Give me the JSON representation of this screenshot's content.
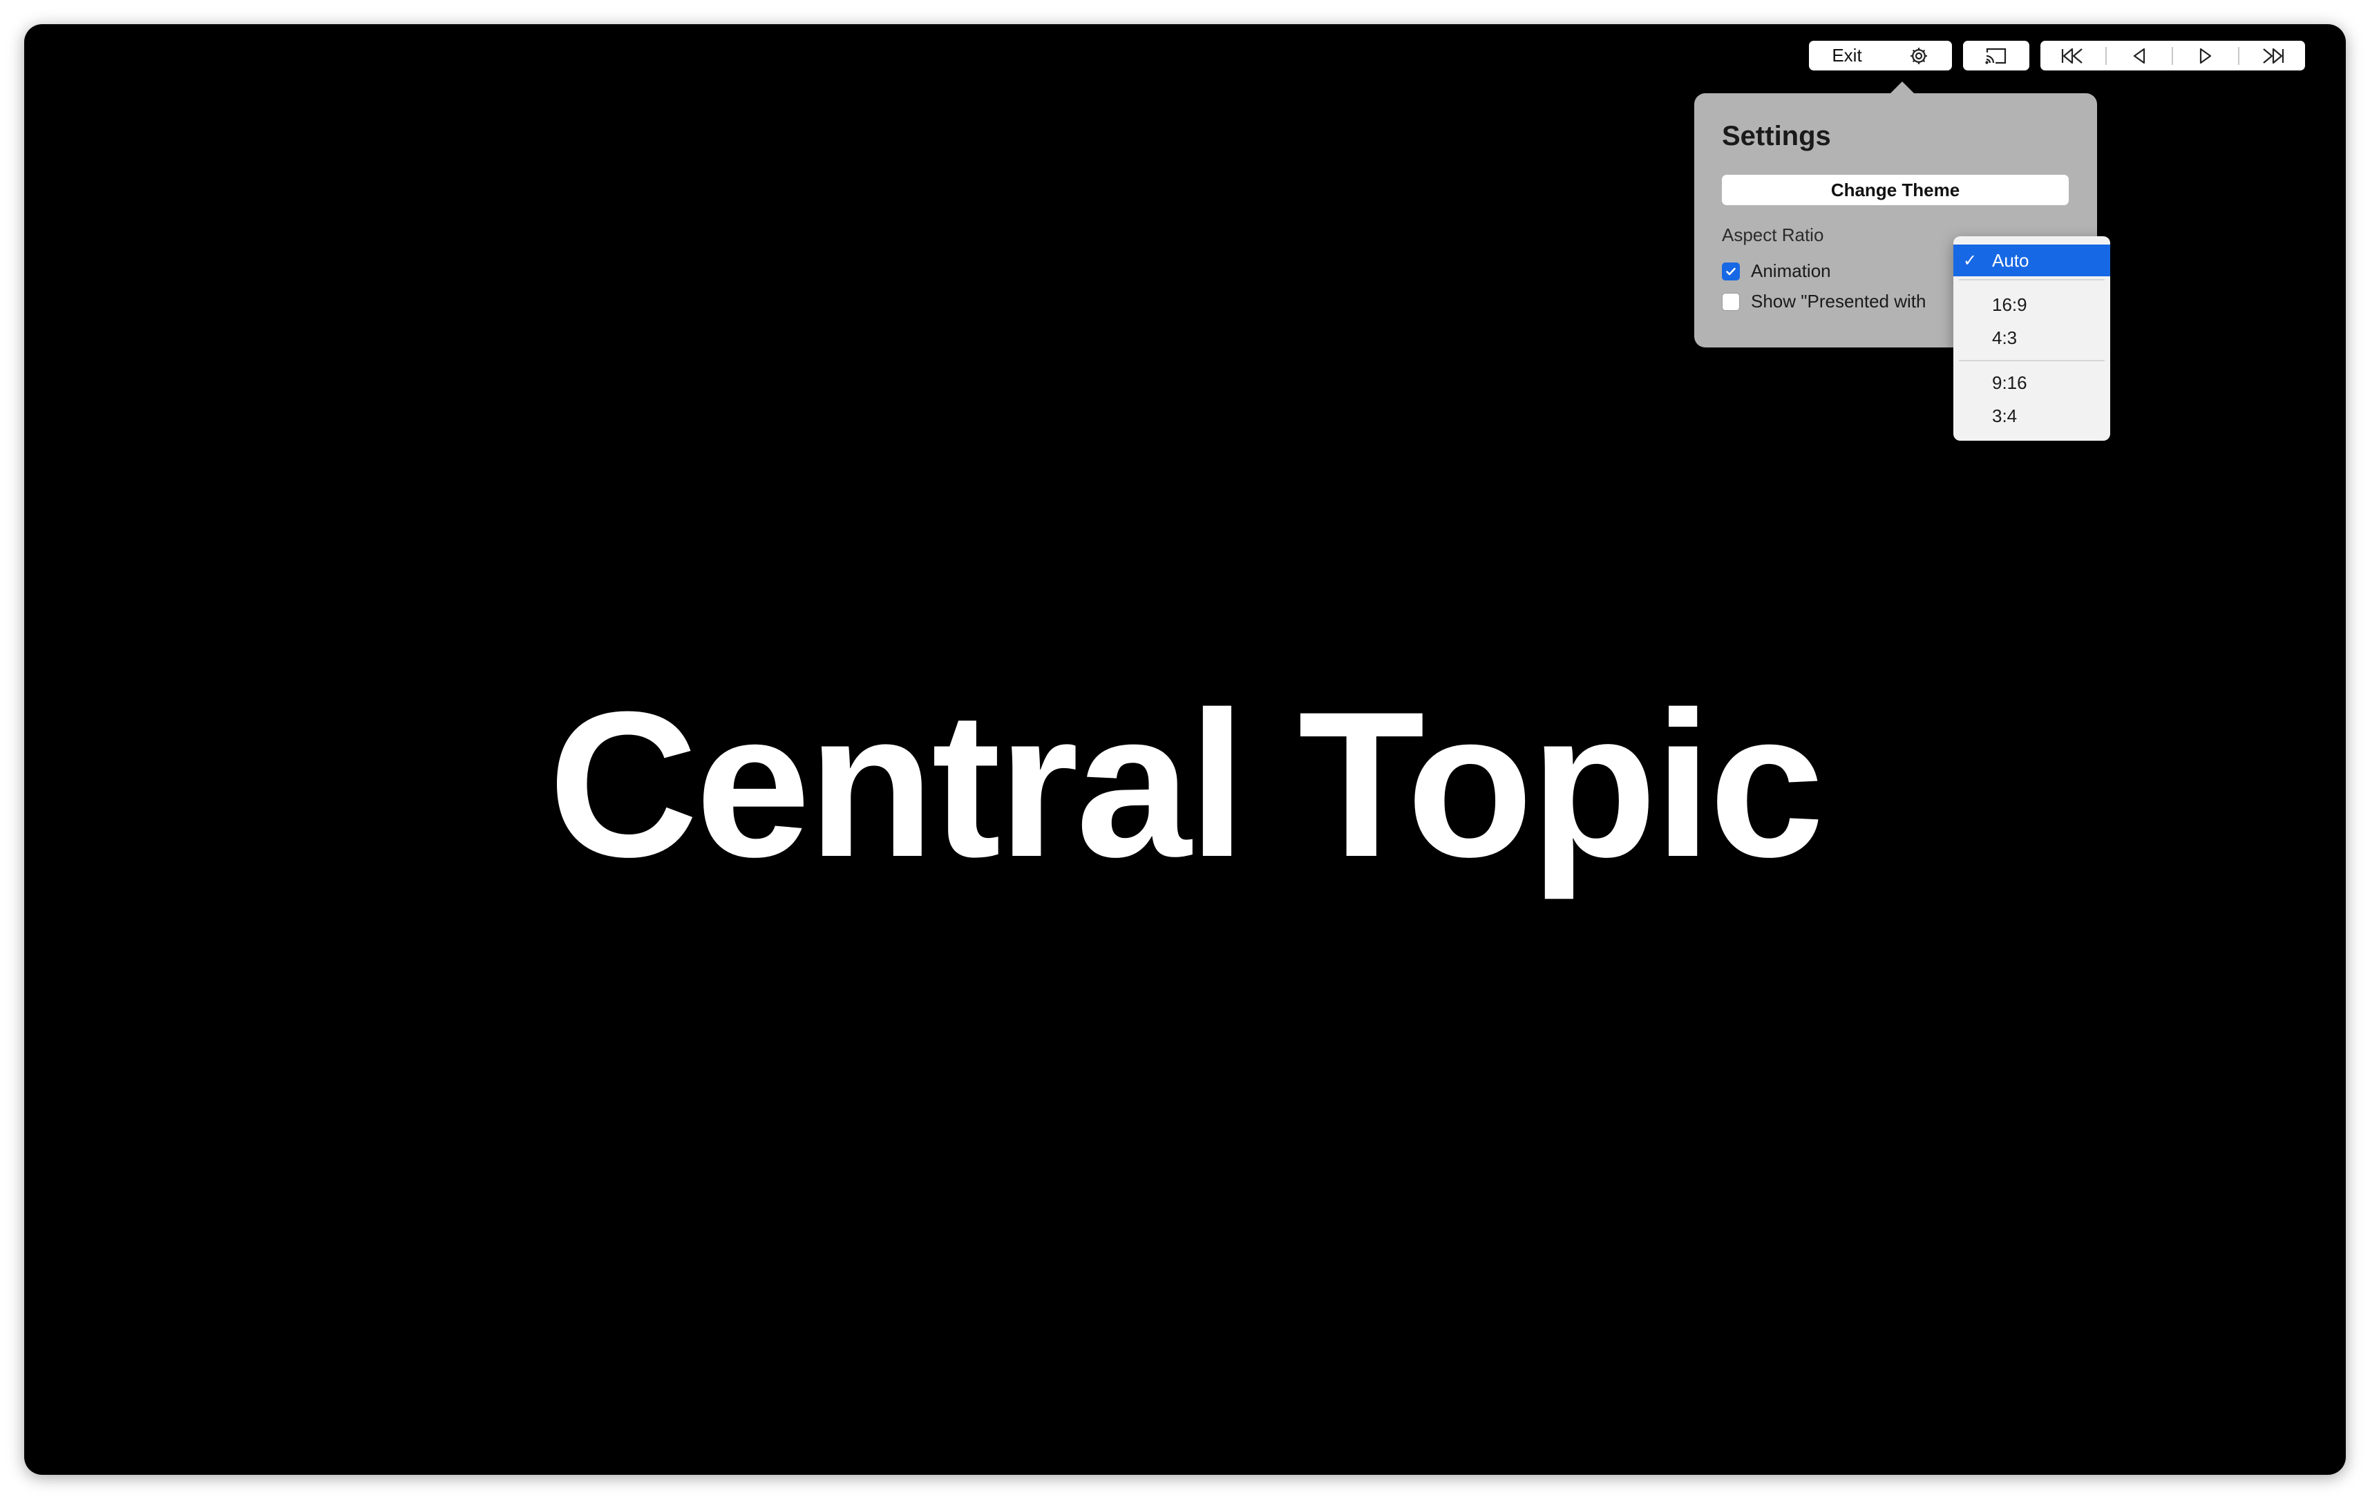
{
  "slide": {
    "title": "Central Topic"
  },
  "toolbar": {
    "exit_label": "Exit",
    "icons": [
      "gear-icon",
      "screen-share-icon",
      "first-slide-icon",
      "previous-slide-icon",
      "next-slide-icon",
      "last-slide-icon"
    ]
  },
  "settings": {
    "title": "Settings",
    "change_theme_label": "Change Theme",
    "aspect_ratio_label": "Aspect Ratio",
    "animation_label": "Animation",
    "animation_checked": true,
    "presented_with_label": "Show \"Presented with",
    "presented_with_checked": false
  },
  "aspect_menu": {
    "selected": "Auto",
    "options": [
      "Auto",
      "16:9",
      "4:3",
      "9:16",
      "3:4"
    ]
  },
  "colors": {
    "accent": "#1768e4",
    "panel": "#b3b3b3",
    "background": "#000000"
  }
}
